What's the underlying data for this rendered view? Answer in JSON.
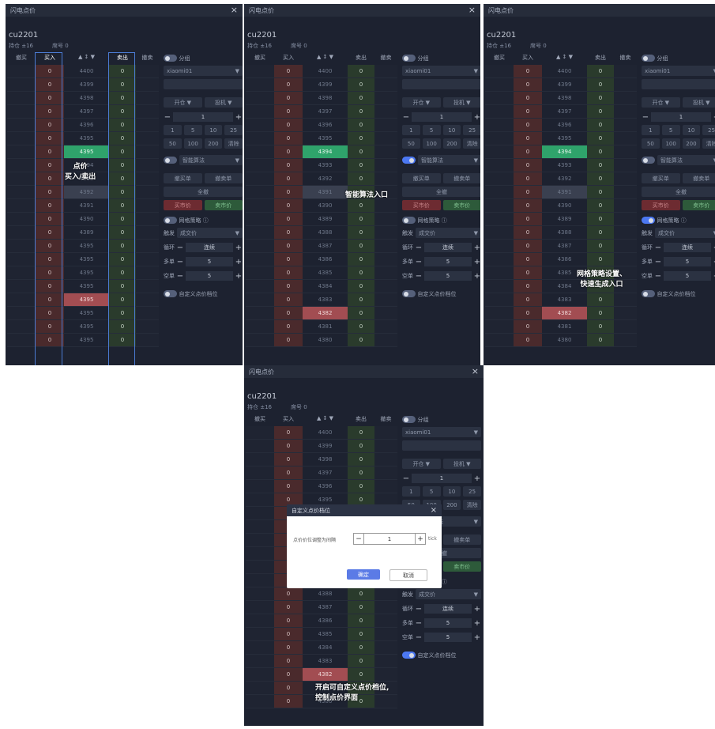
{
  "window": {
    "title": "闪电点价",
    "close": "×"
  },
  "symbol": "cu2201",
  "position": {
    "holding": "持仓  ±16",
    "seat": "席号  0"
  },
  "header": [
    "撤买",
    "买入",
    "▲  ↕  ▼",
    "卖出",
    "撤卖"
  ],
  "prices": [
    "4400",
    "4399",
    "4398",
    "4397",
    "4396",
    "4395",
    "4394",
    "4393",
    "4392",
    "4391",
    "4390",
    "4389",
    "4388",
    "4387",
    "4386",
    "4385",
    "4384",
    "4383",
    "4382",
    "4381",
    "4380"
  ],
  "panel1_prices": [
    "4400",
    "4399",
    "4398",
    "4397",
    "4396",
    "4395",
    "4395",
    "4394",
    "4393",
    "4392",
    "4391",
    "4390",
    "4389",
    "4395",
    "4395",
    "4395",
    "4395",
    "4395",
    "4395",
    "4395",
    "4395"
  ],
  "side": {
    "split_label": "分组",
    "account": "xiaomi01",
    "open": "开仓",
    "speculate": "投机",
    "qty": "1",
    "quick": [
      "1",
      "5",
      "10",
      "25",
      "50",
      "100",
      "200",
      "清除"
    ],
    "algo": "智能算法",
    "cancel_buy": "撤买单",
    "cancel_sell": "撤卖单",
    "cancel_all": "全撤",
    "buy_market": "买市价",
    "sell_market": "卖市价",
    "grid_label": "网格策略 ⓘ",
    "trigger_label": "触发",
    "trigger_value": "成交价",
    "loop_label": "循环",
    "loop_value": "连续",
    "long_label": "多单",
    "long_value": "5",
    "short_label": "空单",
    "short_value": "5",
    "custom_label": "自定义点价档位"
  },
  "annotations": {
    "a1": "点价\n买入/卖出",
    "a2": "智能算法入口",
    "a3": "网格策略设置、\n快速生成入口",
    "a4": "开启可自定义点价档位,\n控制点价界面"
  },
  "modal": {
    "title": "自定义点价档位",
    "label": "点价价位调整为间隔",
    "value": "1",
    "unit": "tick",
    "ok": "确定",
    "cancel": "取消"
  },
  "colors": {
    "bg": "#1d2230",
    "buy": "#4a2a2c",
    "sell": "#2a3b2c",
    "accent": "#4c78f2",
    "highlight": "#2fa36b",
    "red": "#a24d52"
  }
}
